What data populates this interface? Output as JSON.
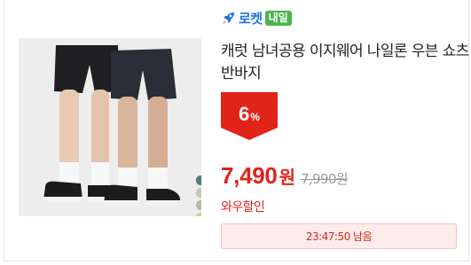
{
  "product": {
    "delivery_badge": {
      "rocket_label": "로켓",
      "sub_label": "내일",
      "icon": "rocket-icon",
      "rocket_color": "#1e73e8",
      "badge_color": "#49b54d"
    },
    "title": "캐럿 남녀공용 이지웨어 나일론 우븐 쇼츠 반바지",
    "discount": {
      "value": "6",
      "unit": "%",
      "color": "#e2231a"
    },
    "price": {
      "current": "7,490",
      "current_unit": "원",
      "original": "7,990원",
      "color": "#e2231a"
    },
    "promo_label": "와우할인",
    "timer": {
      "text": "23:47:50 남음"
    },
    "color_swatches": [
      "#4a7f73",
      "#cdc7b6",
      "#b7b9b5",
      "#c7de8a"
    ],
    "cart_button_icon": "cart-plus-icon"
  }
}
